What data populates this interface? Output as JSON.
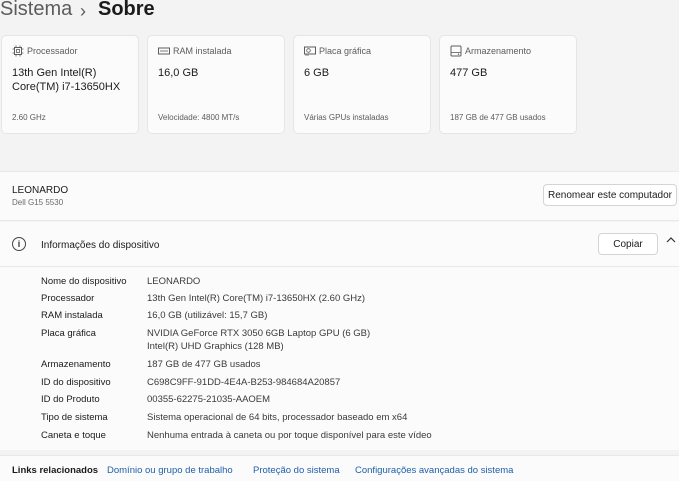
{
  "breadcrumb": {
    "parent": "Sistema",
    "separator": "›",
    "current": "Sobre"
  },
  "cards": [
    {
      "icon": "processor-icon",
      "title": "Processador",
      "value": "13th Gen Intel(R) Core(TM) i7-13650HX",
      "sub": "2.60 GHz"
    },
    {
      "icon": "ram-icon",
      "title": "RAM instalada",
      "value": "16,0 GB",
      "sub": "Velocidade: 4800 MT/s"
    },
    {
      "icon": "gpu-icon",
      "title": "Placa gráfica",
      "value": "6 GB",
      "sub": "Várias GPUs instaladas"
    },
    {
      "icon": "storage-icon",
      "title": "Armazenamento",
      "value": "477 GB",
      "sub": "187 GB de 477 GB usados"
    }
  ],
  "device": {
    "name": "LEONARDO",
    "model": "Dell G15 5530",
    "rename_label": "Renomear este computador"
  },
  "info": {
    "title": "Informações do dispositivo",
    "copy_label": "Copiar",
    "rows": [
      {
        "label": "Nome do dispositivo",
        "value": "LEONARDO"
      },
      {
        "label": "Processador",
        "value": "13th Gen Intel(R) Core(TM) i7-13650HX (2.60 GHz)"
      },
      {
        "label": "RAM instalada",
        "value": "16,0 GB (utilizável: 15,7 GB)"
      },
      {
        "label": "Placa gráfica",
        "value": "NVIDIA GeForce RTX 3050 6GB Laptop GPU (6 GB)",
        "value2": "Intel(R) UHD Graphics (128 MB)"
      },
      {
        "label": "Armazenamento",
        "value": "187 GB de 477 GB usados"
      },
      {
        "label": "ID do dispositivo",
        "value": "C698C9FF-91DD-4E4A-B253-984684A20857"
      },
      {
        "label": "ID do Produto",
        "value": "00355-62275-21035-AAOEM"
      },
      {
        "label": "Tipo de sistema",
        "value": "Sistema operacional de 64 bits, processador baseado em x64"
      },
      {
        "label": "Caneta e toque",
        "value": "Nenhuma entrada à caneta ou por toque disponível para este vídeo"
      }
    ]
  },
  "related": {
    "title": "Links relacionados",
    "links": [
      "Domínio ou grupo de trabalho",
      "Proteção do sistema",
      "Configurações avançadas do sistema"
    ]
  },
  "colors": {
    "background": "#f3f3f3",
    "card": "#fbfbfb",
    "link": "#1f5fa8"
  }
}
